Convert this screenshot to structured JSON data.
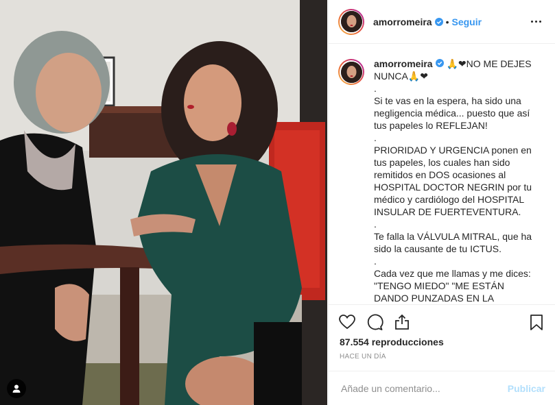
{
  "post": {
    "username": "amorromeira",
    "follow_label": "Seguir",
    "separator": "•",
    "caption": {
      "username": "amorromeira",
      "text": " 🙏❤NO ME DEJES NUNCA🙏❤\n.\nSi te vas en la espera, ha sido una negligencia médica... puesto que así tus papeles lo REFLEJAN!\n.\nPRIORIDAD Y URGENCIA ponen en tus papeles, los cuales han sido remitidos en DOS ocasiones al HOSPITAL DOCTOR NEGRIN por tu médico y cardiólogo del HOSPITAL INSULAR DE FUERTEVENTURA.\n.\nTe falla la VÁLVULA MITRAL, que ha sido la causante de tu ICTUS.\n.\nCada vez que me llamas y me dices: \"TENGO MIEDO\" \"ME ESTÁN DANDO PUNZADAS EN LA CABEZA\" mi"
    },
    "views": "87.554 reproducciones",
    "time": "HACE UN DÍA",
    "comment_placeholder": "Añade un comentario...",
    "publish_label": "Publicar"
  },
  "icons": [
    "user-tag-icon",
    "verified-badge-icon",
    "more-options-icon",
    "heart-icon",
    "comment-icon",
    "share-icon",
    "bookmark-icon"
  ],
  "colors": {
    "link_blue": "#3897f0",
    "publish_disabled": "#b2dffc",
    "muted": "#8e8e8e",
    "verified": "#3897f0"
  }
}
